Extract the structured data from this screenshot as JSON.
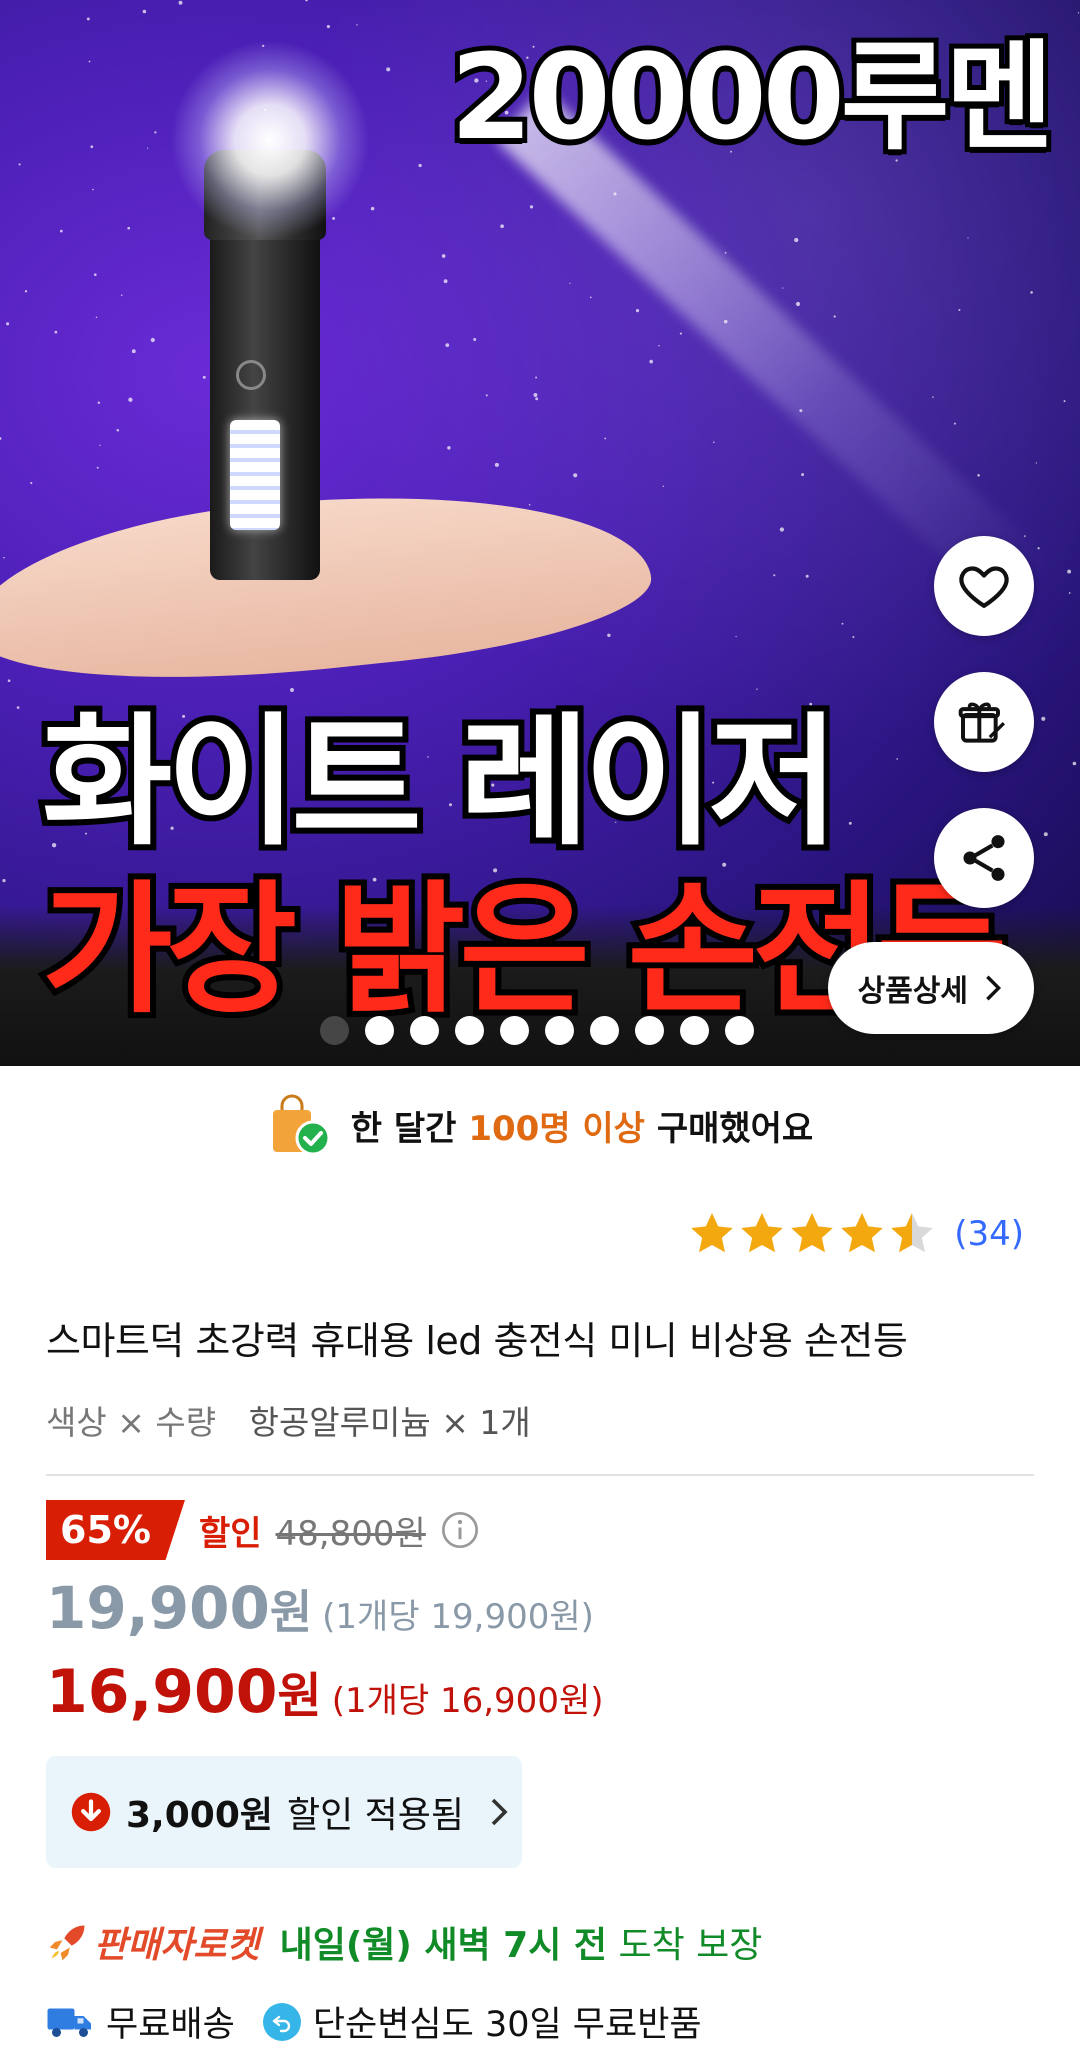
{
  "hero": {
    "lumen_text": "20000루멘",
    "headline_1": "화이트 레이저",
    "headline_2": "가장 밝은 손전등",
    "detail_button": "상품상세",
    "image_count": 10,
    "active_index": 0
  },
  "banner": {
    "prefix": "한 달간",
    "highlight": "100명 이상",
    "suffix": "구매했어요"
  },
  "rating": {
    "stars": 4.5,
    "count": "(34)"
  },
  "product": {
    "title": "스마트덕 초강력 휴대용 led 충전식 미니 비상용 손전등",
    "option_label": "색상 × 수량",
    "option_value": "항공알루미늄 × 1개"
  },
  "pricing": {
    "discount_pct": "65%",
    "discount_label": "할인",
    "original_price": "48,800원",
    "price": "19,900",
    "price_won": "원",
    "price_unit": "(1개당 19,900원)",
    "coupon_price": "16,900",
    "coupon_price_won": "원",
    "coupon_unit": "(1개당 16,900원)",
    "coupon_amount": "3,000원",
    "coupon_text": "할인 적용됨"
  },
  "delivery": {
    "badge": "판매자로켓",
    "arrival_bold": "내일(월) 새벽 7시 전",
    "arrival_rest": "도착 보장",
    "free_shipping": "무료배송",
    "returns": "단순변심도 30일 무료반품"
  },
  "colors": {
    "accent_red": "#d81f06",
    "price_red": "#c1120a",
    "link_blue": "#346aff",
    "green": "#118a28",
    "orange": "#e06a12",
    "star": "#f4a810"
  }
}
